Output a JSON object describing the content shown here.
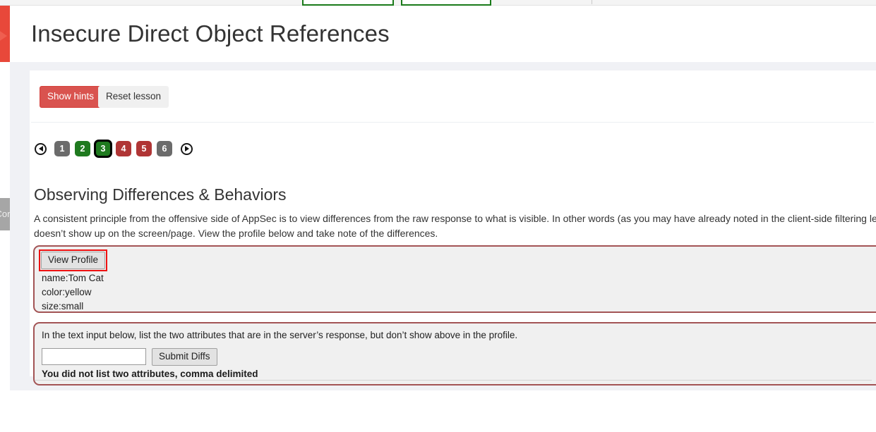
{
  "page": {
    "title": "Insecure Direct Object References"
  },
  "sidebar_tab": {
    "label": "Access Control"
  },
  "toolbar": {
    "show_hints_label": "Show hints",
    "reset_lesson_label": "Reset lesson"
  },
  "pagination": {
    "prev_icon": "arrow-left-icon",
    "next_icon": "arrow-right-icon",
    "items": [
      {
        "label": "1",
        "state": "gray"
      },
      {
        "label": "2",
        "state": "green"
      },
      {
        "label": "3",
        "state": "active-green"
      },
      {
        "label": "4",
        "state": "red"
      },
      {
        "label": "5",
        "state": "red"
      },
      {
        "label": "6",
        "state": "gray"
      }
    ]
  },
  "lesson": {
    "heading": "Observing Differences & Behaviors",
    "paragraph": "A consistent principle from the offensive side of AppSec is to view differences from the raw response to what is visible. In other words (as you may have already noted in the client-side filtering lesson) there is information in the raw response that doesn’t show up on the screen/page. View the profile below and take note of the differences."
  },
  "profile_panel": {
    "view_profile_label": "View Profile",
    "rows": [
      "name:Tom Cat",
      "color:yellow",
      "size:small"
    ]
  },
  "form_panel": {
    "prompt": "In the text input below, list the two attributes that are in the server’s response, but don’t show above in the profile.",
    "input_value": "",
    "input_placeholder": "",
    "submit_label": "Submit Diffs",
    "error": "You did not list two attributes, comma delimited"
  },
  "colors": {
    "accent_red": "#e8483a",
    "hint_button": "#d9534f",
    "panel_border": "#a35455",
    "highlight_box": "#ee1111",
    "green_box_border": "#1a7a1a",
    "pager_green": "#1f7a1f",
    "pager_red": "#b03535",
    "pager_gray": "#6b6b6b"
  }
}
